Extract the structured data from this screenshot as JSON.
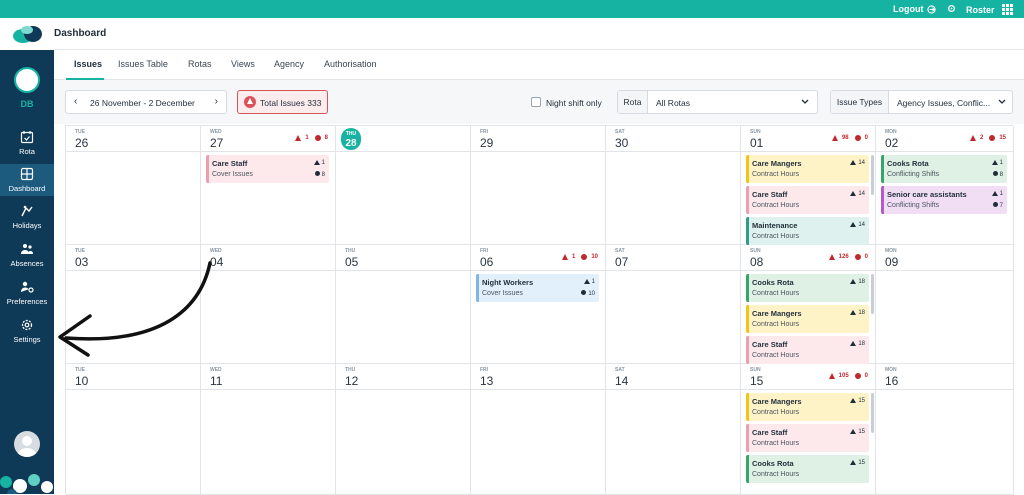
{
  "topbar": {
    "logout_label": "Logout",
    "roster_label": "Roster"
  },
  "header": {
    "title": "Dashboard"
  },
  "tabs": [
    "Issues",
    "Issues Table",
    "Rotas",
    "Views",
    "Agency",
    "Authorisation"
  ],
  "sidebar": {
    "initials": "DB",
    "items": [
      {
        "label": "Rota",
        "icon": "calendar-check-icon"
      },
      {
        "label": "Dashboard",
        "icon": "dashboard-icon"
      },
      {
        "label": "Holidays",
        "icon": "holiday-icon"
      },
      {
        "label": "Absences",
        "icon": "absences-icon"
      },
      {
        "label": "Preferences",
        "icon": "preferences-icon"
      },
      {
        "label": "Settings",
        "icon": "gear-icon"
      }
    ]
  },
  "controls": {
    "date_range": "26 November - 2 December",
    "total_issues": "Total Issues 333",
    "night_shift_label": "Night shift only",
    "rota_label": "Rota",
    "rota_value": "All Rotas",
    "issue_types_label": "Issue Types",
    "issue_types_value": "Agency Issues, Conflic..."
  },
  "calendar": {
    "weeks": [
      {
        "days": [
          {
            "dow": "TUE",
            "num": "26"
          },
          {
            "dow": "WED",
            "num": "27",
            "warn": "1",
            "err": "8",
            "cards": [
              {
                "title": "Care Staff",
                "sub": "Cover Issues",
                "c1": "1",
                "c2": "8",
                "color": "pink"
              }
            ]
          },
          {
            "dow": "THU",
            "num": "28",
            "today": true
          },
          {
            "dow": "FRI",
            "num": "29"
          },
          {
            "dow": "SAT",
            "num": "30"
          },
          {
            "dow": "SUN",
            "num": "01",
            "warn": "98",
            "err": "0",
            "cards": [
              {
                "title": "Care Mangers",
                "sub": "Contract Hours",
                "c1": "14",
                "color": "yellow"
              },
              {
                "title": "Care Staff",
                "sub": "Contract Hours",
                "c1": "14",
                "color": "pink"
              },
              {
                "title": "Maintenance",
                "sub": "Contract Hours",
                "c1": "14",
                "color": "teal"
              }
            ]
          },
          {
            "dow": "MON",
            "num": "02",
            "warn": "2",
            "err": "15",
            "cards": [
              {
                "title": "Cooks Rota",
                "sub": "Conflicting Shifts",
                "c1": "1",
                "c2": "8",
                "color": "green"
              },
              {
                "title": "Senior care assistants",
                "sub": "Conflicting Shifts",
                "c1": "1",
                "c2": "7",
                "color": "purple"
              }
            ]
          }
        ]
      },
      {
        "days": [
          {
            "dow": "TUE",
            "num": "03"
          },
          {
            "dow": "WED",
            "num": "04"
          },
          {
            "dow": "THU",
            "num": "05"
          },
          {
            "dow": "FRI",
            "num": "06",
            "warn": "1",
            "err": "10",
            "cards": [
              {
                "title": "Night Workers",
                "sub": "Cover Issues",
                "c1": "1",
                "c2": "10",
                "color": "blue"
              }
            ]
          },
          {
            "dow": "SAT",
            "num": "07"
          },
          {
            "dow": "SUN",
            "num": "08",
            "warn": "126",
            "err": "0",
            "cards": [
              {
                "title": "Cooks Rota",
                "sub": "Contract Hours",
                "c1": "18",
                "color": "green"
              },
              {
                "title": "Care Mangers",
                "sub": "Contract Hours",
                "c1": "18",
                "color": "yellow"
              },
              {
                "title": "Care Staff",
                "sub": "Contract Hours",
                "c1": "18",
                "color": "pink"
              }
            ]
          },
          {
            "dow": "MON",
            "num": "09"
          }
        ]
      },
      {
        "days": [
          {
            "dow": "TUE",
            "num": "10"
          },
          {
            "dow": "WED",
            "num": "11"
          },
          {
            "dow": "THU",
            "num": "12"
          },
          {
            "dow": "FRI",
            "num": "13"
          },
          {
            "dow": "SAT",
            "num": "14"
          },
          {
            "dow": "SUN",
            "num": "15",
            "warn": "105",
            "err": "0",
            "cards": [
              {
                "title": "Care Mangers",
                "sub": "Contract Hours",
                "c1": "15",
                "color": "yellow"
              },
              {
                "title": "Care Staff",
                "sub": "Contract Hours",
                "c1": "15",
                "color": "pink"
              },
              {
                "title": "Cooks Rota",
                "sub": "Contract Hours",
                "c1": "15",
                "color": "green"
              }
            ]
          },
          {
            "dow": "MON",
            "num": "16"
          }
        ]
      }
    ]
  },
  "colors": {
    "pink": {
      "bg": "#fde8ec",
      "bar": "#e7a1b0"
    },
    "yellow": {
      "bg": "#fdf3c6",
      "bar": "#f0c419"
    },
    "teal": {
      "bg": "#dff1ee",
      "bar": "#2f9c8c"
    },
    "green": {
      "bg": "#dff1e5",
      "bar": "#3aa36b"
    },
    "purple": {
      "bg": "#f1def5",
      "bar": "#b35ac7"
    },
    "blue": {
      "bg": "#e2f0fb",
      "bar": "#7fb6e3"
    }
  }
}
